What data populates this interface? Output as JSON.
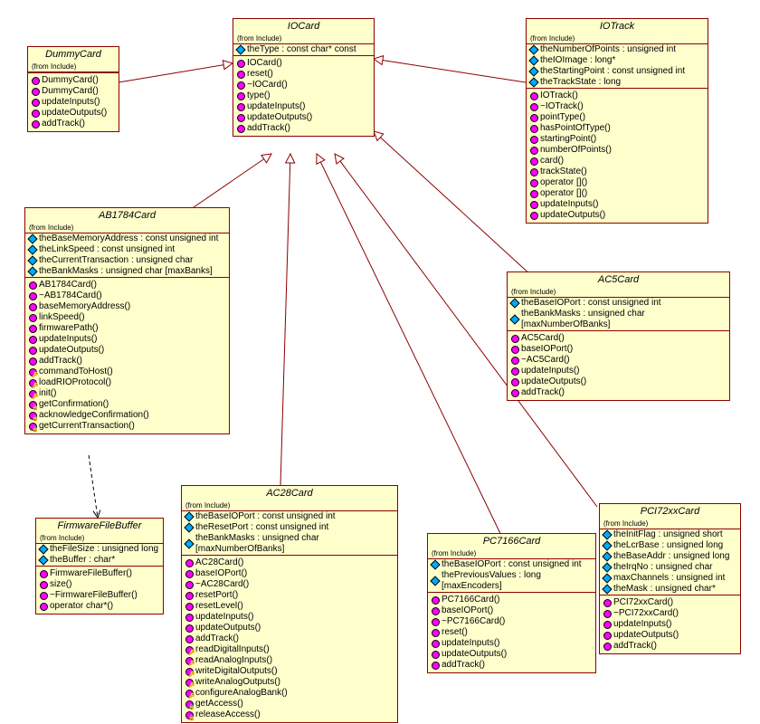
{
  "from_text": "(from Include)",
  "classes": {
    "DummyCard": {
      "name": "DummyCard",
      "methods": [
        "DummyCard()",
        "DummyCard()",
        "updateInputs()",
        "updateOutputs()",
        "addTrack()"
      ]
    },
    "IOCard": {
      "name": "IOCard",
      "attrs": [
        "theType : const char* const"
      ],
      "methods": [
        "IOCard()",
        "reset()",
        "~IOCard()",
        "type()",
        "updateInputs()",
        "updateOutputs()",
        "addTrack()"
      ]
    },
    "IOTrack": {
      "name": "IOTrack",
      "attrs": [
        "theNumberOfPoints : unsigned int",
        "theIOImage : long*",
        "theStartingPoint : const unsigned int",
        "theTrackState : long"
      ],
      "methods": [
        "IOTrack()",
        "~IOTrack()",
        "pointType()",
        "hasPointOfType()",
        "startingPoint()",
        "numberOfPoints()",
        "card()",
        "trackState()",
        "operator []()",
        "operator []()",
        "updateInputs()",
        "updateOutputs()"
      ]
    },
    "AB1784Card": {
      "name": "AB1784Card",
      "attrs": [
        "theBaseMemoryAddress : const unsigned int",
        "theLinkSpeed : const unsigned int",
        "theCurrentTransaction : unsigned char",
        "theBankMasks : unsigned char [maxBanks]"
      ],
      "methods": [
        "AB1784Card()",
        "~AB1784Card()",
        "baseMemoryAddress()",
        "linkSpeed()",
        "firmwarePath()",
        "updateInputs()",
        "updateOutputs()",
        "addTrack()",
        "commandToHost()",
        "loadRIOProtocol()",
        "init()",
        "getConfirmation()",
        "acknowledgeConfirmation()",
        "getCurrentTransaction()"
      ]
    },
    "AC5Card": {
      "name": "AC5Card",
      "attrs": [
        "theBaseIOPort : const unsigned int",
        "theBankMasks : unsigned char [maxNumberOfBanks]"
      ],
      "methods": [
        "AC5Card()",
        "baseIOPort()",
        "~AC5Card()",
        "updateInputs()",
        "updateOutputs()",
        "addTrack()"
      ]
    },
    "FirmwareFileBuffer": {
      "name": "FirmwareFileBuffer",
      "attrs": [
        "theFileSize : unsigned long",
        "theBuffer : char*"
      ],
      "methods": [
        "FirmwareFileBuffer()",
        "size()",
        "~FirmwareFileBuffer()",
        "operator char*()"
      ]
    },
    "AC28Card": {
      "name": "AC28Card",
      "attrs": [
        "theBaseIOPort : const unsigned int",
        "theResetPort : const unsigned int",
        "theBankMasks : unsigned char [maxNumberOfBanks]"
      ],
      "methods": [
        "AC28Card()",
        "baseIOPort()",
        "~AC28Card()",
        "resetPort()",
        "resetLevel()",
        "updateInputs()",
        "updateOutputs()",
        "addTrack()",
        "readDigitalInputs()",
        "readAnalogInputs()",
        "writeDigitalOutputs()",
        "writeAnalogOutputs()",
        "configureAnalogBank()",
        "getAccess()",
        "releaseAccess()"
      ]
    },
    "PC7166Card": {
      "name": "PC7166Card",
      "attrs": [
        "theBaseIOPort : const unsigned int",
        "thePreviousValues : long [maxEncoders]"
      ],
      "methods": [
        "PC7166Card()",
        "baseIOPort()",
        "~PC7166Card()",
        "reset()",
        "updateInputs()",
        "updateOutputs()",
        "addTrack()"
      ]
    },
    "PCI72xxCard": {
      "name": "PCI72xxCard",
      "attrs": [
        "theInitFlag : unsigned short",
        "theLcrBase : unsigned long",
        "theBaseAddr : unsigned long",
        "theIrqNo : unsigned char",
        "maxChannels : unsigned int",
        "theMask : unsigned char*"
      ],
      "methods": [
        "PCI72xxCard()",
        "~PCI72xxCard()",
        "updateInputs()",
        "updateOutputs()",
        "addTrack()"
      ]
    }
  }
}
